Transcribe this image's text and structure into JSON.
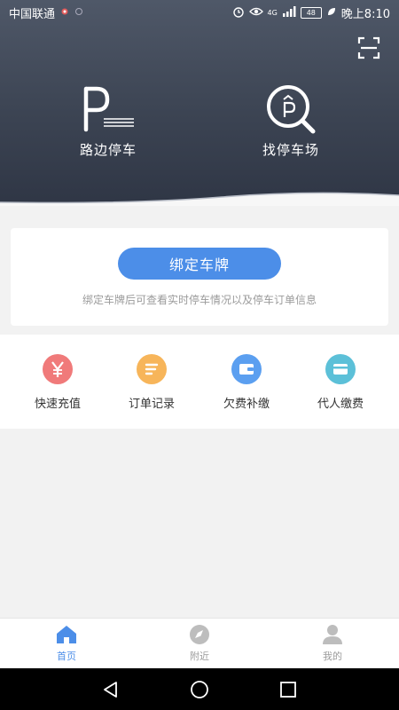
{
  "status_bar": {
    "carrier": "中国联通",
    "network": "4G",
    "battery": "48",
    "time": "晚上8:10"
  },
  "header": {
    "actions": [
      {
        "label": "路边停车",
        "icon": "roadside-parking-icon"
      },
      {
        "label": "找停车场",
        "icon": "find-parking-lot-icon"
      }
    ],
    "scan_icon": "scan-icon"
  },
  "bind_card": {
    "button_label": "绑定车牌",
    "hint": "绑定车牌后可查看实时停车情况以及停车订单信息"
  },
  "quick_actions": [
    {
      "label": "快速充值",
      "icon": "yen-icon",
      "color": "#f07a7a"
    },
    {
      "label": "订单记录",
      "icon": "list-icon",
      "color": "#f7b55a"
    },
    {
      "label": "欠费补缴",
      "icon": "wallet-icon",
      "color": "#5b9ff0"
    },
    {
      "label": "代人缴费",
      "icon": "card-icon",
      "color": "#5cc0d8"
    }
  ],
  "bottom_nav": [
    {
      "label": "首页",
      "icon": "home-icon",
      "active": true
    },
    {
      "label": "附近",
      "icon": "compass-icon",
      "active": false
    },
    {
      "label": "我的",
      "icon": "user-icon",
      "active": false
    }
  ],
  "colors": {
    "accent": "#4c8ee8",
    "header_dark": "#2f3645",
    "inactive": "#bdbdbd"
  }
}
